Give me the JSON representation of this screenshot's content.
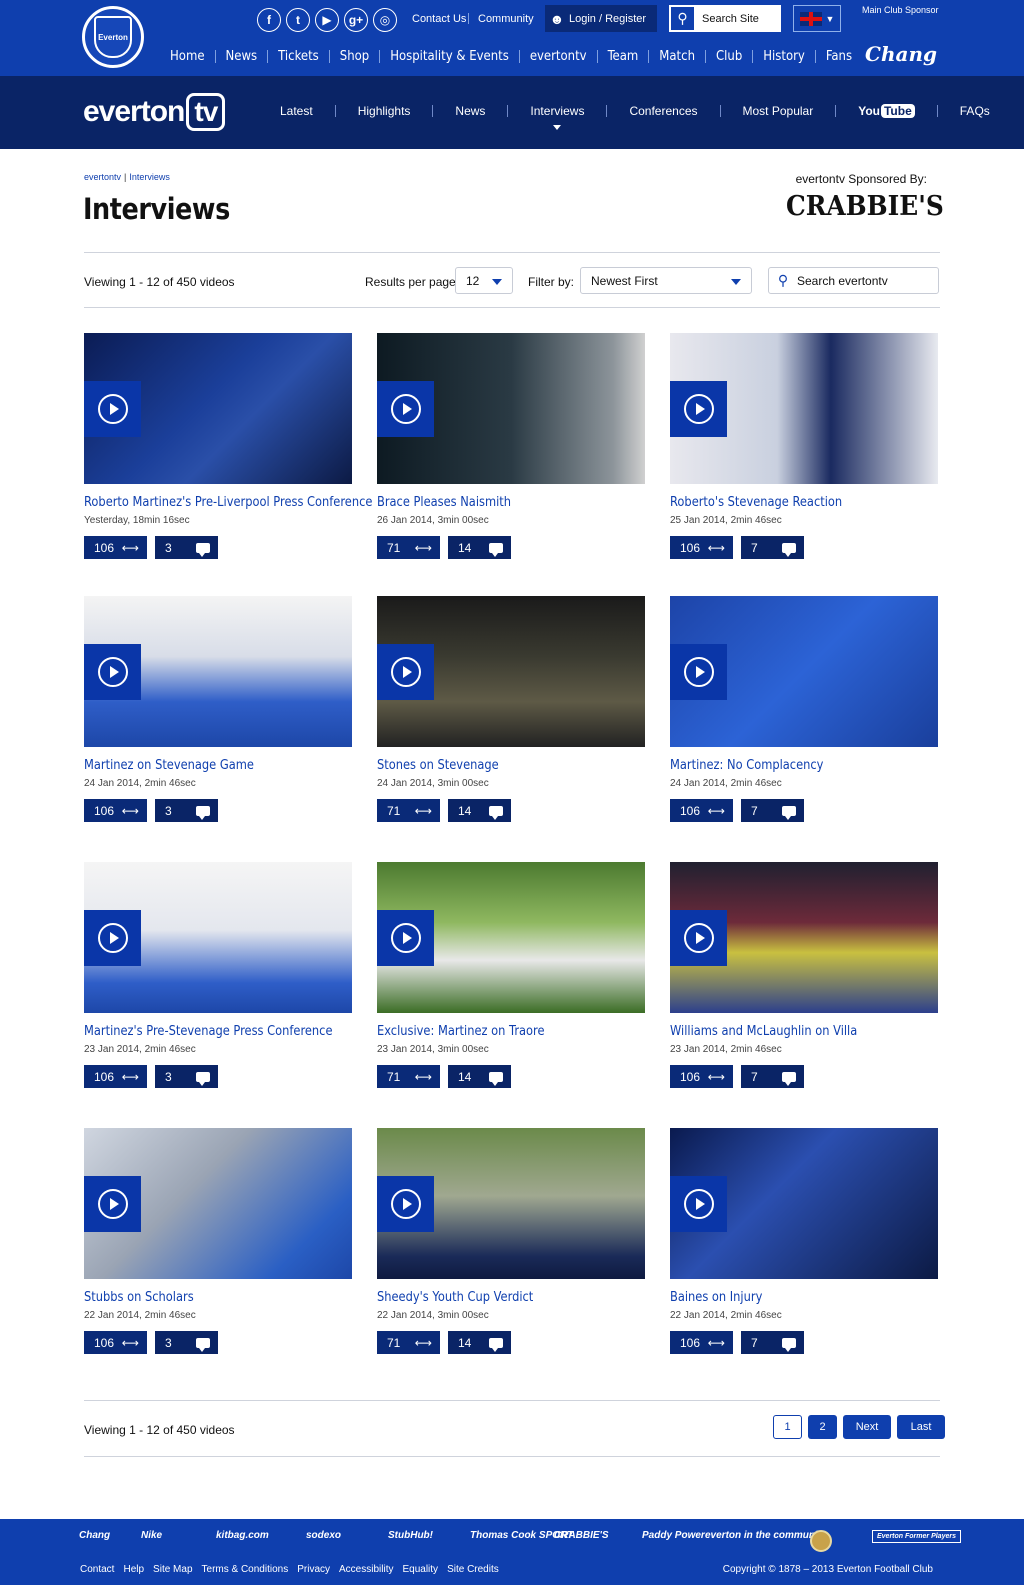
{
  "header": {
    "crest_label": "Everton",
    "social": [
      {
        "icon": "facebook-icon",
        "glyph": "f"
      },
      {
        "icon": "twitter-icon",
        "glyph": "t"
      },
      {
        "icon": "youtube-icon",
        "glyph": "▶"
      },
      {
        "icon": "google-plus-icon",
        "glyph": "g+"
      },
      {
        "icon": "instagram-icon",
        "glyph": "◎"
      }
    ],
    "contact_us": "Contact Us",
    "community": "Community",
    "login": "Login / Register",
    "search_placeholder": "Search Site",
    "main_sponsor_label": "Main Club Sponsor",
    "main_sponsor_name": "Chang",
    "nav": [
      "Home",
      "News",
      "Tickets",
      "Shop",
      "Hospitality & Events",
      "evertontv",
      "Team",
      "Match",
      "Club",
      "History",
      "Fans"
    ]
  },
  "tv": {
    "logo_text": "everton",
    "logo_box": "tv",
    "nav": [
      "Latest",
      "Highlights",
      "News",
      "Interviews",
      "Conferences",
      "Most Popular"
    ],
    "youtube_you": "You",
    "youtube_tube": "Tube",
    "faqs": "FAQs",
    "active": "Interviews"
  },
  "page": {
    "breadcrumb": [
      "evertontv",
      "Interviews"
    ],
    "breadcrumb_sep": "|",
    "title": "Interviews",
    "sponsored_by": "evertontv Sponsored By:",
    "sponsor_name": "CRABBIE'S",
    "viewing": "Viewing 1 - 12 of 450 videos",
    "results_per_page_label": "Results per page:",
    "results_per_page": "12",
    "filter_label": "Filter by:",
    "filter_value": "Newest First",
    "search_placeholder": "Search evertontv"
  },
  "videos": [
    {
      "title": "Roberto Martinez's Pre-Liverpool Press Conference",
      "date": "Yesterday, 18min 16sec",
      "shares": "106",
      "comments": "3"
    },
    {
      "title": "Brace Pleases Naismith",
      "date": "26 Jan 2014, 3min 00sec",
      "shares": "71",
      "comments": "14"
    },
    {
      "title": "Roberto's Stevenage Reaction",
      "date": "25 Jan 2014, 2min 46sec",
      "shares": "106",
      "comments": "7"
    },
    {
      "title": "Martinez on Stevenage Game",
      "date": "24 Jan 2014, 2min 46sec",
      "shares": "106",
      "comments": "3"
    },
    {
      "title": "Stones on Stevenage",
      "date": "24 Jan 2014, 3min 00sec",
      "shares": "71",
      "comments": "14"
    },
    {
      "title": "Martinez: No Complacency",
      "date": "24 Jan 2014, 2min 46sec",
      "shares": "106",
      "comments": "7"
    },
    {
      "title": "Martinez's Pre-Stevenage Press Conference",
      "date": "23 Jan 2014, 2min 46sec",
      "shares": "106",
      "comments": "3"
    },
    {
      "title": "Exclusive: Martinez on Traore",
      "date": "23 Jan 2014, 3min 00sec",
      "shares": "71",
      "comments": "14"
    },
    {
      "title": "Williams and McLaughlin on Villa",
      "date": "23 Jan 2014, 2min 46sec",
      "shares": "106",
      "comments": "7"
    },
    {
      "title": "Stubbs on Scholars",
      "date": "22 Jan 2014, 2min 46sec",
      "shares": "106",
      "comments": "3"
    },
    {
      "title": "Sheedy's Youth Cup Verdict",
      "date": "22 Jan 2014, 3min 00sec",
      "shares": "71",
      "comments": "14"
    },
    {
      "title": "Baines on Injury",
      "date": "22 Jan 2014, 2min 46sec",
      "shares": "106",
      "comments": "7"
    }
  ],
  "pagination": {
    "viewing": "Viewing 1 - 12 of 450 videos",
    "pages": [
      "1",
      "2"
    ],
    "current": "1",
    "next": "Next",
    "last": "Last"
  },
  "footer": {
    "logos": [
      "Chang",
      "Nike",
      "kitbag.com",
      "sodexo",
      "StubHub!",
      "Thomas Cook SPORT",
      "CRABBIE'S",
      "Paddy Power",
      "everton in the community",
      "",
      "Everton Former Players"
    ],
    "links": [
      "Contact",
      "Help",
      "Site Map",
      "Terms & Conditions",
      "Privacy",
      "Accessibility",
      "Equality",
      "Site Credits"
    ],
    "copyright": "Copyright © 1878 – 2013 Everton Football Club"
  },
  "colors": {
    "brand_blue": "#0f3fae",
    "tv_navy": "#0a2466",
    "stat_navy": "#0a2a78"
  }
}
